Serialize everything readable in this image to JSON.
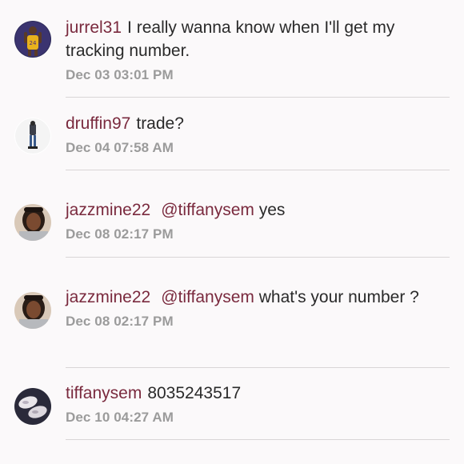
{
  "comments": [
    {
      "username": "jurrel31",
      "mention": "",
      "text": "I really wanna know when I'll get my tracking number.",
      "timestamp": "Dec 03 03:01 PM",
      "avatar_icon": "user-avatar-basketball-player"
    },
    {
      "username": "druffin97",
      "mention": "",
      "text": "trade?",
      "timestamp": "Dec 04 07:58 AM",
      "avatar_icon": "user-avatar-standing-person"
    },
    {
      "username": "jazzmine22",
      "mention": "@tiffanysem",
      "text": "yes",
      "timestamp": "Dec 08 02:17 PM",
      "avatar_icon": "user-avatar-selfie"
    },
    {
      "username": "jazzmine22",
      "mention": "@tiffanysem",
      "text": "what's your number ?",
      "timestamp": "Dec 08 02:17 PM",
      "avatar_icon": "user-avatar-selfie"
    },
    {
      "username": "tiffanysem",
      "mention": "",
      "text": "8035243517",
      "timestamp": "Dec 10 04:27 AM",
      "avatar_icon": "user-avatar-shoes"
    }
  ],
  "colors": {
    "background": "#fbf9fa",
    "username": "#7a2a3e",
    "body_text": "#2a2a2a",
    "timestamp": "#9b9b9b",
    "divider": "#d9d6d7"
  }
}
